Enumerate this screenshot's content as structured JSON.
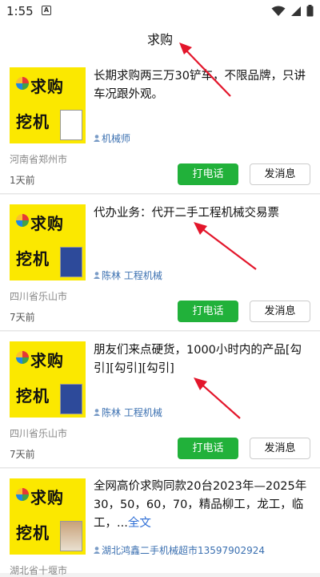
{
  "status_bar": {
    "time": "1:55",
    "notification_letter": "A"
  },
  "header": {
    "title": "求购"
  },
  "thumbnail": {
    "line1": "求购",
    "line2": "挖机"
  },
  "buttons": {
    "call": "打电话",
    "message": "发消息"
  },
  "listings": [
    {
      "description": "长期求购两三万30铲车，不限品牌，只讲车况跟外观。",
      "author": "机械师",
      "location": "河南省郑州市",
      "time": "1天前",
      "more": ""
    },
    {
      "description": "代办业务：代开二手工程机械交易票",
      "author": "陈林 工程机械",
      "location": "四川省乐山市",
      "time": "7天前",
      "more": ""
    },
    {
      "description": "朋友们来点硬货，1000小时内的产品[勾引][勾引][勾引]",
      "author": "陈林 工程机械",
      "location": "四川省乐山市",
      "time": "7天前",
      "more": ""
    },
    {
      "description": "全网高价求购同款20台2023年—2025年30，50，60，70，精品柳工，龙工，临工，...",
      "author": "湖北鸿鑫二手机械超市13597902924",
      "location": "湖北省十堰市",
      "time": "",
      "more": "全文"
    }
  ],
  "colors": {
    "call_button": "#21b13a",
    "thumb_bg": "#fbe800",
    "author_link": "#3a6fb0",
    "annotation_arrow": "#e3162b"
  }
}
